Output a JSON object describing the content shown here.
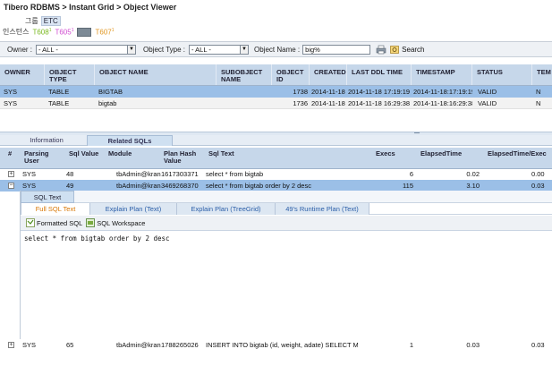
{
  "breadcrumb": "Tibero RDBMS > Instant Grid > Object Viewer",
  "group": {
    "label": "그룹",
    "value": "ETC"
  },
  "instance": {
    "label": "인스턴스",
    "items": [
      "T608",
      "T605",
      "T607"
    ],
    "marks": [
      "1",
      "1",
      "1"
    ]
  },
  "filters": {
    "owner_label": "Owner :",
    "owner_value": "- ALL -",
    "type_label": "Object Type :",
    "type_value": "- ALL -",
    "name_label": "Object Name :",
    "name_value": "big%",
    "search_label": "Search"
  },
  "object_grid": {
    "headers": [
      "OWNER",
      "OBJECT TYPE",
      "OBJECT NAME",
      "SUBOBJECT NAME",
      "OBJECT ID",
      "CREATED",
      "LAST DDL TIME",
      "TIMESTAMP",
      "STATUS",
      "TEM"
    ],
    "rows": [
      [
        "SYS",
        "TABLE",
        "BIGTAB",
        "",
        "1738",
        "2014-11-18 1",
        "2014-11-18 17:19:19",
        "2014-11-18:17:19:19",
        "VALID",
        "N"
      ],
      [
        "SYS",
        "TABLE",
        "bigtab",
        "",
        "1736",
        "2014-11-18 1",
        "2014-11-18 16:29:38",
        "2014-11-18:16:29:38",
        "VALID",
        "N"
      ]
    ]
  },
  "tabs": {
    "information": "Information",
    "related_sqls": "Related SQLs"
  },
  "sql_grid": {
    "headers": [
      "#",
      "Parsing User",
      "Sql Value",
      "Module",
      "Plan Hash Value",
      "Sql Text",
      "Execs",
      "ElapsedTime",
      "ElapsedTime/Exec"
    ],
    "rows": [
      {
        "expander": "+",
        "user": "SYS",
        "sql_value": "48",
        "module": "tbAdmin@kranI.",
        "plan_hash": "1617303371",
        "sql_text": "select * from bigtab",
        "execs": "6",
        "elapsed": "0.02",
        "per_exec": "0.00"
      },
      {
        "expander": "−",
        "user": "SYS",
        "sql_value": "49",
        "module": "tbAdmin@kranI.",
        "plan_hash": "3469268370",
        "sql_text": "select * from bigtab order by 2 desc",
        "execs": "115",
        "elapsed": "3.10",
        "per_exec": "0.03"
      },
      {
        "expander": "+",
        "user": "SYS",
        "sql_value": "65",
        "module": "tbAdmin@kranI.",
        "plan_hash": "1788265026",
        "sql_text": "INSERT INTO bigtab (id, weight, adate) SELECT MOD(",
        "execs": "1",
        "elapsed": "0.03",
        "per_exec": "0.03"
      }
    ]
  },
  "detail": {
    "tab_label": "SQL Text",
    "subtabs": [
      "Full SQL Text",
      "Explain Plan (Text)",
      "Explain Plan (TreeGrid)",
      "49's Runtime Plan (Text)"
    ],
    "toolbar": {
      "formatted": "Formatted SQL",
      "workspace": "SQL Workspace"
    },
    "sql": "select * from bigtab order by 2 desc"
  }
}
